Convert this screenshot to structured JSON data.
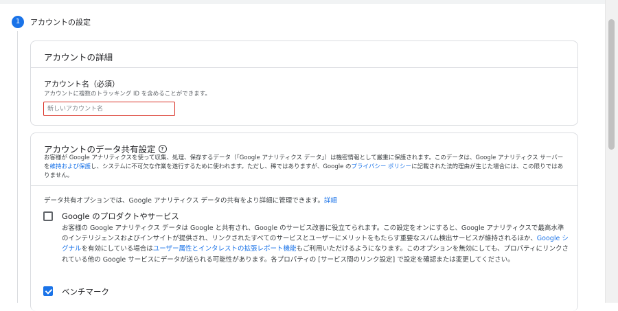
{
  "step": {
    "number": "1",
    "title": "アカウントの設定"
  },
  "account_details": {
    "title": "アカウントの詳細",
    "field_label": "アカウント名（必須）",
    "field_help": "アカウントに複数のトラッキング ID を含めることができます。",
    "input_value": "",
    "input_placeholder": "新しいアカウント名"
  },
  "data_sharing": {
    "title": "アカウントのデータ共有設定",
    "desc_1": "お客様が Google アナリティクスを使って収集、処理、保存するデータ（「Google アナリティクス データ」）は機密情報として厳重に保護されます。このデータは、Google アナリティクス サーバーを",
    "desc_link_1": "維持および保護",
    "desc_2": "し、システムに不可欠な作業を遂行するために使われます。ただし、稀ではありますが、Google の",
    "desc_link_2": "プライバシー ポリシー",
    "desc_3": "に記載された法的理由が生じた場合には、この限りではありません。",
    "options_intro": "データ共有オプションでは、Google アナリティクス データの共有をより詳細に管理できます。",
    "options_intro_link": "詳細",
    "options": [
      {
        "title": "Google のプロダクトやサービス",
        "checked": false,
        "desc_1": "お客様の Google アナリティクス データは Google と共有され、Google のサービス改善に役立てられます。この設定をオンにすると、Google アナリティクスで最高水準のインテリジェンスおよびインサイトが提供され、リンクされたすべてのサービスとユーザーにメリットをもたらす重要なスパム検出サービスが維持されるほか、",
        "link_1": "Google シグナル",
        "desc_2": "を有効にしている場合は",
        "link_2": "ユーザー属性とインタレストの拡張レポート機能",
        "desc_3": "もご利用いただけるようになります。このオプションを無効にしても、プロパティにリンクされている他の Google サービスにデータが送られる可能性があります。各プロパティの [サービス間のリンク設定] で設定を確認または変更してください。"
      },
      {
        "title": "ベンチマーク",
        "checked": true
      }
    ]
  },
  "colors": {
    "accent": "#1a73e8",
    "error": "#d93025",
    "border": "#dadce0"
  }
}
